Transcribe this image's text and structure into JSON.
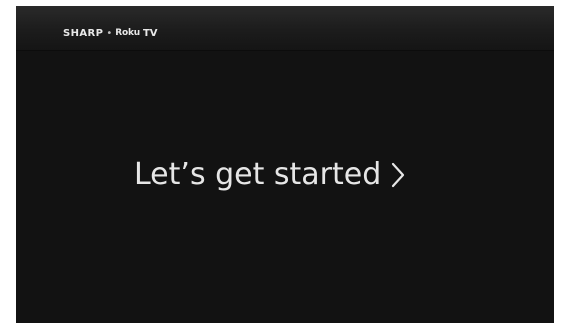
{
  "header": {
    "brand_sharp": "SHARP",
    "brand_separator": "•",
    "brand_roku": "Roku",
    "brand_tv": "TV"
  },
  "main": {
    "prompt_label": "Let’s get started",
    "prompt_icon": "chevron-right-icon"
  },
  "colors": {
    "screen_background": "#121212",
    "text": "#e6e6e6"
  }
}
